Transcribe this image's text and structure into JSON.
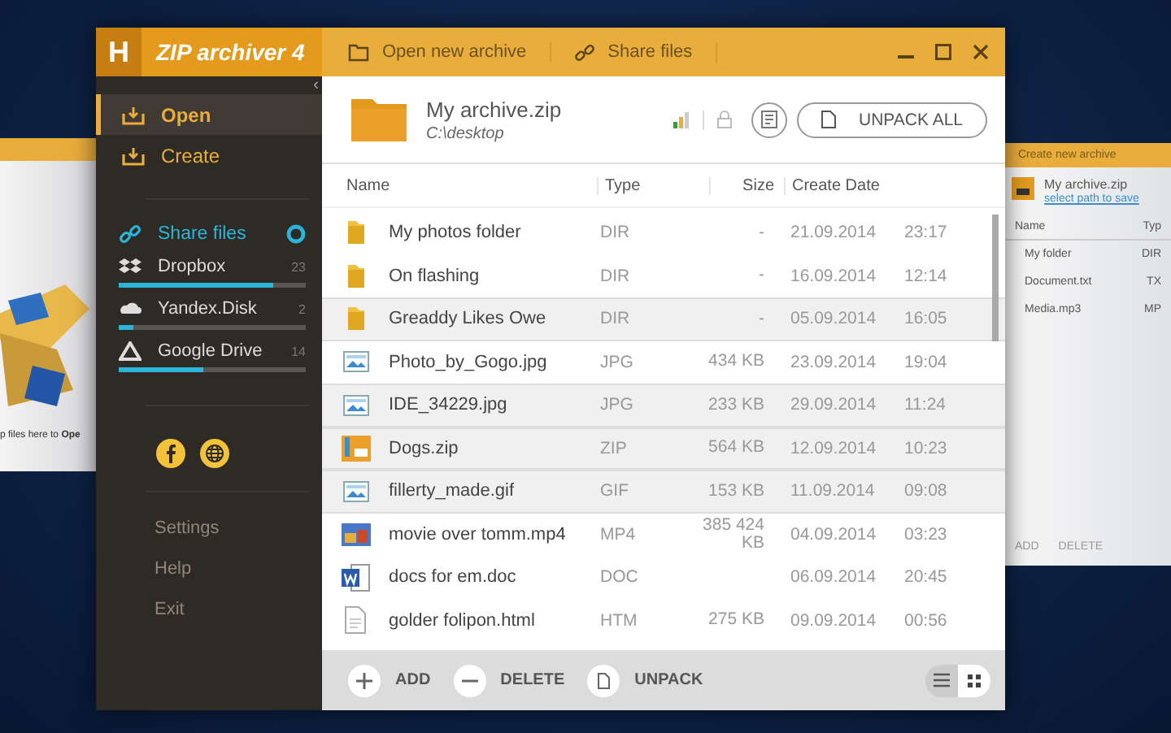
{
  "app": {
    "logo_letter": "H",
    "title": "ZIP archiver 4",
    "collapse_glyph": "‹"
  },
  "sidebar": {
    "nav": [
      {
        "label": "Open",
        "selected": true
      },
      {
        "label": "Create",
        "selected": false
      }
    ],
    "share": {
      "label": "Share files"
    },
    "clouds": [
      {
        "kind": "dropbox",
        "name": "Dropbox",
        "count": "23",
        "level": 0.83
      },
      {
        "kind": "yandex",
        "name": "Yandex.Disk",
        "count": "2",
        "level": 0.08
      },
      {
        "kind": "gdrive",
        "name": "Google Drive",
        "count": "14",
        "level": 0.45
      }
    ],
    "footer": [
      "Settings",
      "Help",
      "Exit"
    ]
  },
  "toolbar": {
    "actions": [
      {
        "kind": "folder",
        "label": "Open new archive"
      },
      {
        "kind": "link",
        "label": "Share files"
      }
    ]
  },
  "archive": {
    "name": "My archive.zip",
    "path": "C:\\desktop",
    "unpack_all": "UNPACK ALL"
  },
  "table": {
    "columns": [
      "Name",
      "Type",
      "Size",
      "Create Date"
    ],
    "rows": [
      {
        "kind": "folder",
        "name": "My photos folder",
        "type": "DIR",
        "size": "-",
        "date": "21.09.2014",
        "time": "23:17",
        "selected": false
      },
      {
        "kind": "folder",
        "name": "On flashing",
        "type": "DIR",
        "size": "-",
        "date": "16.09.2014",
        "time": "12:14",
        "selected": false
      },
      {
        "kind": "folder",
        "name": "Greaddy Likes Owe",
        "type": "DIR",
        "size": "-",
        "date": "05.09.2014",
        "time": "16:05",
        "selected": true
      },
      {
        "kind": "image",
        "name": "Photo_by_Gogo.jpg",
        "type": "JPG",
        "size": "434 KB",
        "date": "23.09.2014",
        "time": "19:04",
        "selected": false
      },
      {
        "kind": "image",
        "name": "IDE_34229.jpg",
        "type": "JPG",
        "size": "233 KB",
        "date": "29.09.2014",
        "time": "11:24",
        "selected": true
      },
      {
        "kind": "zip",
        "name": "Dogs.zip",
        "type": "ZIP",
        "size": "564 KB",
        "date": "12.09.2014",
        "time": "10:23",
        "selected": true
      },
      {
        "kind": "image",
        "name": "fillerty_made.gif",
        "type": "GIF",
        "size": "153 KB",
        "date": "11.09.2014",
        "time": "09:08",
        "selected": true
      },
      {
        "kind": "video",
        "name": "movie over tomm.mp4",
        "type": "MP4",
        "size": "385 424 KB",
        "date": "04.09.2014",
        "time": "03:23",
        "selected": false
      },
      {
        "kind": "word",
        "name": "docs for em.doc",
        "type": "DOC",
        "date": "06.09.2014",
        "time": "20:45",
        "selected": false
      },
      {
        "kind": "html",
        "name": "golder folipon.html",
        "type": "HTM",
        "size": "275 KB",
        "date": "09.09.2014",
        "time": "00:56",
        "selected": false
      }
    ]
  },
  "bottom_bar": {
    "actions": [
      {
        "kind": "add",
        "label": "ADD"
      },
      {
        "kind": "delete",
        "label": "DELETE"
      },
      {
        "kind": "unpack",
        "label": "UNPACK"
      }
    ],
    "view_modes": [
      {
        "kind": "list",
        "selected": true
      },
      {
        "kind": "grid",
        "selected": false
      }
    ]
  },
  "background_windows": {
    "left": {
      "hint": "p files here to **Ope**"
    },
    "right": {
      "toolbar": "Create new archive",
      "name": "My archive.zip",
      "path_link": "select path to save",
      "columns": [
        "Name",
        "Typ"
      ],
      "files": [
        {
          "name": "My folder",
          "type": "DIR"
        },
        {
          "name": "Document.txt",
          "type": "TX"
        },
        {
          "name": "Media.mp3",
          "type": "MP"
        }
      ],
      "actions": [
        "ADD",
        "DELETE"
      ]
    }
  }
}
